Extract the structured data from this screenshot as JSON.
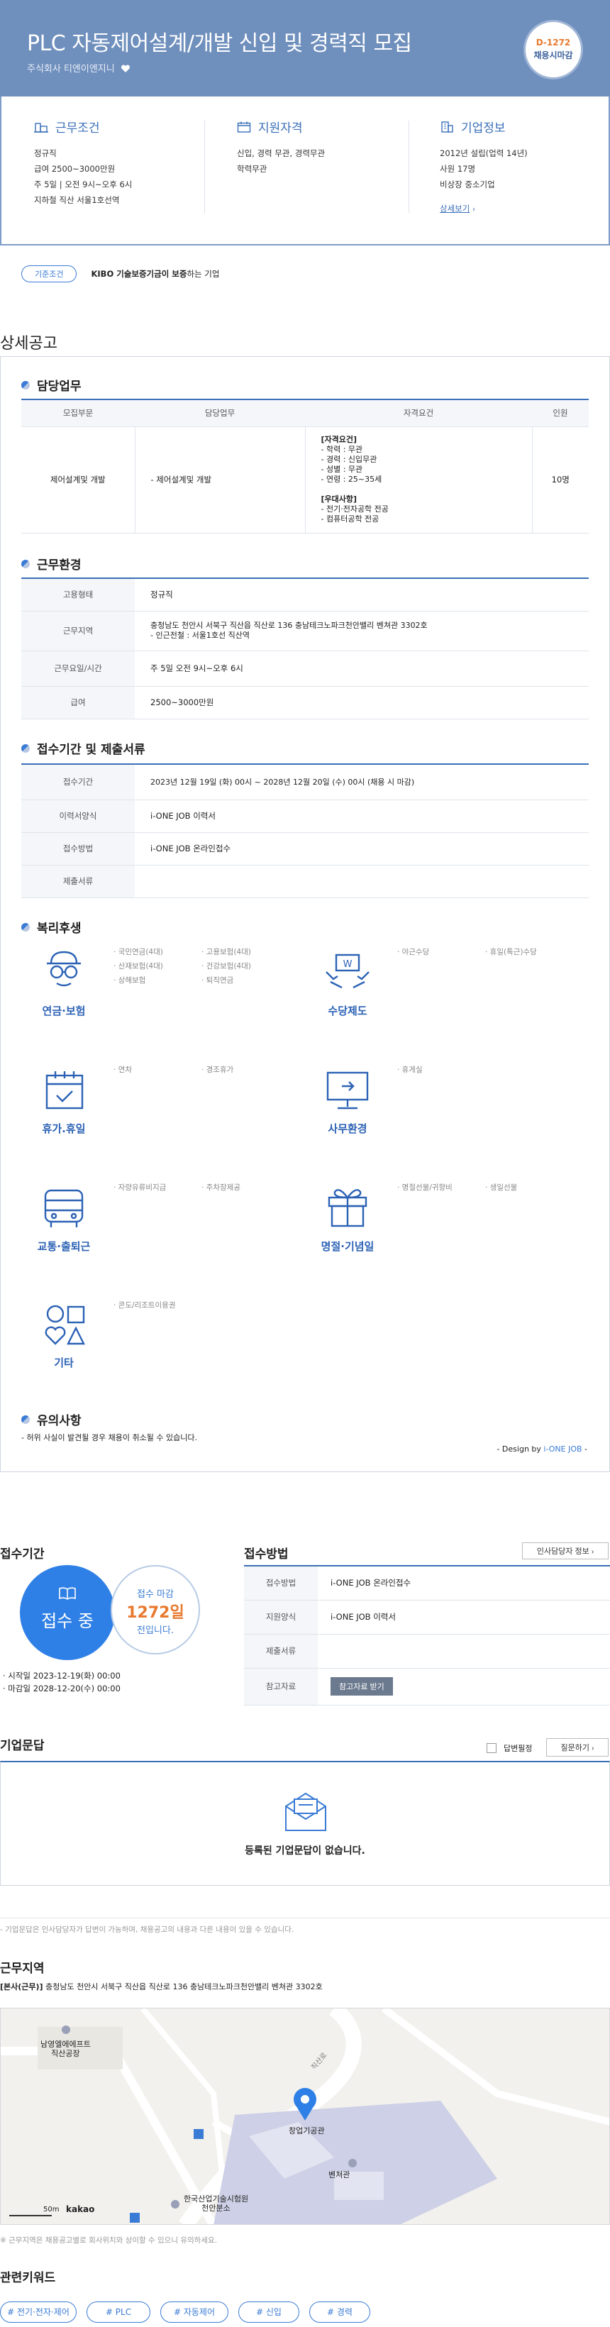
{
  "header": {
    "title": "PLC 자동제어설계/개발 신입 및 경력직 모집",
    "company": "주식회사 티엔이엔지니",
    "dday_count": "D-1272",
    "dday_text": "채용시마감"
  },
  "summary": {
    "conditions": {
      "heading": "근무조건",
      "lines": [
        "정규직",
        "급여 2500~3000만원",
        "주 5일 | 오전 9시~오후 6시",
        "지하철 직산 서울1호선역"
      ]
    },
    "qualifications": {
      "heading": "지원자격",
      "lines": [
        "신입, 경력 무관, 경력무관",
        "학력무관"
      ]
    },
    "company_info": {
      "heading": "기업정보",
      "lines": [
        "2012년 설립(업력 14년)",
        "사원 17명",
        "비상장 중소기업"
      ],
      "more": "상세보기"
    }
  },
  "badge": {
    "pill": "기준조건",
    "text_bold": "KIBO 기술보증기금이 보증",
    "text_rest": "하는 기업"
  },
  "detail": {
    "section_title": "상세공고",
    "duty": {
      "heading": "담당업무",
      "columns": [
        "모집부문",
        "담당업무",
        "자격요건",
        "인원"
      ],
      "row": {
        "dept": "제어설계및 개발",
        "task": "- 제어설계및 개발",
        "req_title": "[자격요건]",
        "req_lines": [
          "- 학력 : 무관",
          "- 경력 : 신입무관",
          "- 성별 : 무관",
          "- 연령 : 25~35세"
        ],
        "pref_title": "[우대사항]",
        "pref_lines": [
          "- 전기·전자공학 전공",
          "- 컴퓨터공학 전공"
        ],
        "count": "10명"
      }
    },
    "environment": {
      "heading": "근무환경",
      "rows": [
        {
          "label": "고용형태",
          "value": "정규직"
        },
        {
          "label": "근무지역",
          "value": "충청남도 천안시 서북구 직산읍 직산로 136 충남테크노파크천안밸리 벤쳐관 3302호",
          "value2": "- 인근전철 : 서울1호선 직산역"
        },
        {
          "label": "근무요일/시간",
          "value": "주 5일 오전 9시~오후 6시"
        },
        {
          "label": "급여",
          "value": "2500~3000만원"
        }
      ]
    },
    "application": {
      "heading": "접수기간 및 제출서류",
      "rows": [
        {
          "label": "접수기간",
          "value": "2023년 12월 19일 (화) 00시 ~ 2028년 12월 20일 (수) 00시 (채용 시 마감)"
        },
        {
          "label": "이력서양식",
          "value": "i-ONE JOB 이력서"
        },
        {
          "label": "접수방법",
          "value": "i-ONE JOB 온라인접수"
        },
        {
          "label": "제출서류",
          "value": ""
        }
      ]
    },
    "benefits": {
      "heading": "복리후생",
      "groups": [
        {
          "label": "연금·보험",
          "items": [
            "· 국민연금(4대)",
            "· 고용보험(4대)",
            "· 산재보험(4대)",
            "· 건강보험(4대)",
            "· 상해보험",
            "· 퇴직연금"
          ]
        },
        {
          "label": "수당제도",
          "items": [
            "· 야근수당",
            "· 휴일(특근)수당"
          ]
        },
        {
          "label": "휴가.휴일",
          "items": [
            "· 연차",
            "· 경조휴가"
          ]
        },
        {
          "label": "사무환경",
          "items": [
            "· 휴게실"
          ]
        },
        {
          "label": "교통·출퇴근",
          "items": [
            "· 자량유류비지급",
            "· 주차장제공"
          ]
        },
        {
          "label": "명절·기념일",
          "items": [
            "· 명절선물/귀향비",
            "· 생일선물"
          ]
        },
        {
          "label": "기타",
          "items": [
            "· 콘도/리조트이용권"
          ]
        }
      ]
    },
    "notice": {
      "heading": "유의사항",
      "text": "- 허위 사실이 발견될 경우 채용이 취소될 수 있습니다.",
      "design_prefix": "- Design by ",
      "design_brand": "i-ONE JOB",
      "design_suffix": " -"
    }
  },
  "period": {
    "heading": "접수기간",
    "status": "접수 중",
    "deadline_label": "접수 마감",
    "deadline_days": "1272일",
    "deadline_suffix": "전입니다.",
    "start": "· 시작일 2023-12-19(화) 00:00",
    "end": "· 마감일 2028-12-20(수) 00:00"
  },
  "method": {
    "heading": "접수방법",
    "contact_button": "인사담당자 정보",
    "rows": [
      {
        "label": "접수방법",
        "value": "i-ONE JOB 온라인접수"
      },
      {
        "label": "지원양식",
        "value": "i-ONE JOB 이력서"
      },
      {
        "label": "제출서류",
        "value": ""
      },
      {
        "label": "참고자료",
        "value": ""
      }
    ],
    "ref_button": "참고자료 받기"
  },
  "qa": {
    "heading": "기업문답",
    "checkbox_label": "답변필정",
    "ask_button": "질문하기",
    "empty": "등록된 기업문답이 없습니다.",
    "note": "- 기업문답은 인사담당자가 답변이 가능하며, 채용공고의 내용과 다른 내용이 있을 수 있습니다."
  },
  "location": {
    "heading": "근무지역",
    "tag": "[본사(근무)]",
    "address": "충청남도 천안시 서북구 직산읍 직산로 136 충남테크노파크천안밸리 벤쳐관 3302호",
    "map_labels": {
      "place1": "남영엘에에프트",
      "place1b": "직산공장",
      "pin": "창업기공관",
      "building": "벤쳐관",
      "place2": "한국산업기술시험원",
      "place2b": "천안분소",
      "road": "직산로",
      "scale": "50m",
      "brand": "kakao"
    },
    "note": "※ 근무지역은 채용공고별로 회사위치와 상이할 수 있으니 유의하세요."
  },
  "keywords": {
    "heading": "관련키워드",
    "items": [
      "# 전기·전자·제어",
      "# PLC",
      "# 자동제어",
      "# 신입",
      "# 경력"
    ]
  },
  "colors": {
    "brand_blue": "#3a6fb8",
    "accent_orange": "#e8792f",
    "header_bg": "#6f8fbd"
  }
}
